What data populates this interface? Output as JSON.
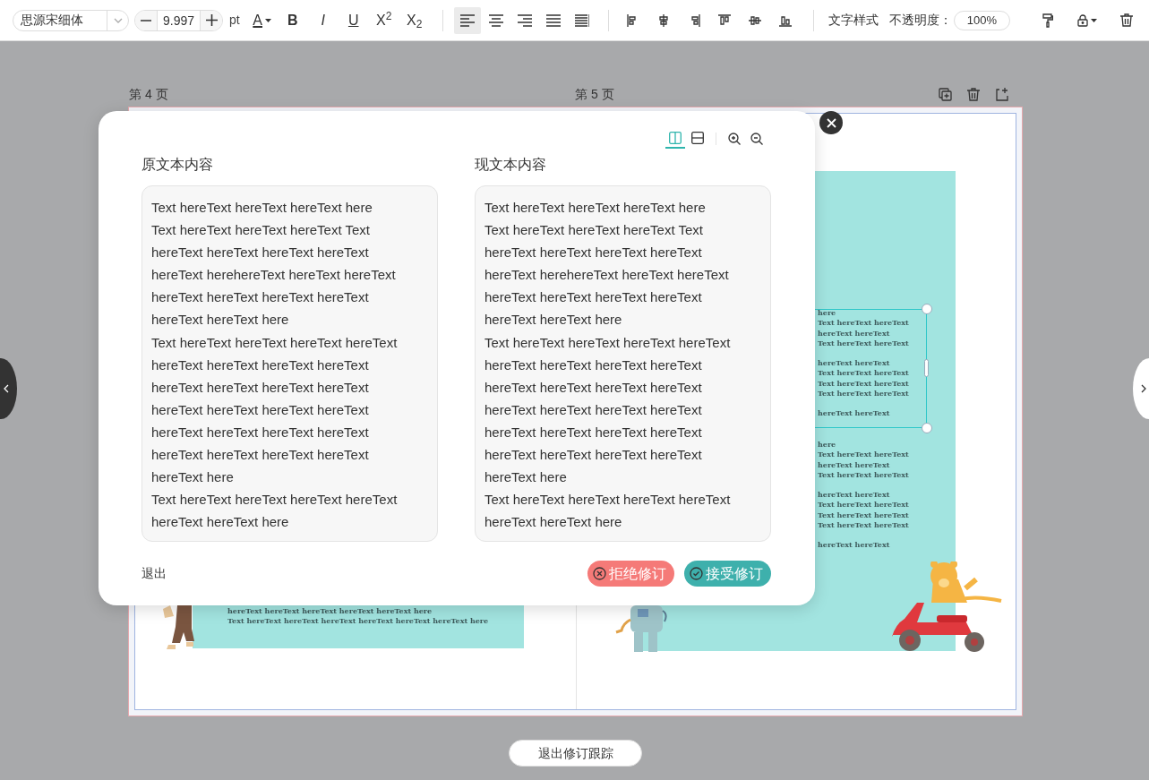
{
  "toolbar": {
    "font_family": {
      "value": "思源宋细体"
    },
    "font_size": {
      "value": "9.997",
      "unit": "pt"
    },
    "format_buttons": [
      {
        "label": "A",
        "kind": "color"
      },
      {
        "label": "B",
        "kind": "bold"
      },
      {
        "label": "I",
        "kind": "italic"
      },
      {
        "label": "U",
        "kind": "underline"
      },
      {
        "label": "X$^{2}$",
        "kind": "plain"
      },
      {
        "label": "X$_{2}$",
        "kind": "plain"
      }
    ],
    "text_align": [
      {
        "kind": "left",
        "selected": true
      },
      {
        "kind": "center",
        "selected": false
      },
      {
        "kind": "right",
        "selected": false
      },
      {
        "kind": "justify",
        "selected": false
      },
      {
        "kind": "distributed",
        "selected": false
      }
    ],
    "text_style_label": "文字样式",
    "opacity": {
      "label": "不透明度：",
      "value": "100%"
    }
  },
  "pages": [
    {
      "label": "第 4 页"
    },
    {
      "label": "第 5 页"
    }
  ],
  "left_page_text": [
    "hereText hereText hereText hereText hereText here",
    "Text hereText hereText hereText hereText hereText hereText here"
  ],
  "right_page_text": [
    {
      "paragraphs": [
        [
          "here",
          "Text hereText hereText",
          "hereText hereText",
          "Text hereText hereText"
        ],
        [
          "hereText hereText",
          "Text hereText hereText",
          "Text hereText hereText",
          "Text hereText hereText"
        ],
        [
          "hereText hereText"
        ]
      ]
    },
    {
      "paragraphs": [
        [
          "here",
          "Text hereText hereText",
          "hereText hereText",
          "Text hereText hereText"
        ],
        [
          "hereText hereText",
          "Text hereText hereText",
          "Text hereText hereText",
          "Text hereText hereText"
        ],
        [
          "hereText hereText"
        ]
      ]
    }
  ],
  "modal": {
    "view_buttons": [
      {
        "kind": "split",
        "selected": true
      },
      {
        "kind": "stacked",
        "selected": false
      }
    ],
    "original": {
      "title": "原文本内容",
      "lines": [
        "Text hereText hereText hereText here",
        "Text hereText hereText hereText Text",
        "hereText hereText hereText hereText",
        "hereText herehereText hereText hereText",
        "hereText hereText hereText hereText",
        "hereText hereText here",
        "Text hereText hereText hereText hereText",
        "hereText hereText hereText hereText",
        "hereText hereText hereText hereText",
        "hereText hereText hereText hereText",
        "hereText hereText hereText hereText",
        "hereText hereText hereText hereText",
        "hereText here",
        "Text hereText hereText hereText hereText",
        "hereText hereText here"
      ]
    },
    "revised": {
      "title": "现文本内容",
      "lines": [
        "Text hereText hereText hereText here",
        "Text hereText hereText hereText Text",
        "hereText hereText hereText hereText",
        "hereText herehereText hereText hereText",
        "hereText hereText hereText hereText",
        "hereText hereText here",
        "Text hereText hereText hereText hereText",
        "hereText hereText hereText hereText",
        "hereText hereText hereText hereText",
        "hereText hereText hereText hereText",
        "hereText hereText hereText hereText",
        "hereText hereText hereText hereText",
        "hereText here",
        "Text hereText hereText hereText hereText",
        "hereText hereText here"
      ]
    },
    "exit_link": "退出",
    "reject_button": "拒绝修订",
    "accept_button": "接受修订"
  },
  "exit_tracking_button": "退出修订跟踪"
}
